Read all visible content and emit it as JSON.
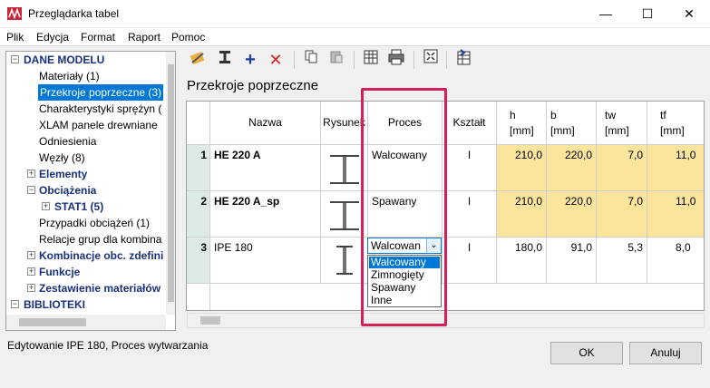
{
  "window": {
    "title": "Przeglądarka tabel"
  },
  "menu": [
    "Plik",
    "Edycja",
    "Format",
    "Raport",
    "Pomoc"
  ],
  "tree": {
    "root": "DANE MODELU",
    "items": [
      "Materiały (1)",
      "Przekroje poprzeczne (3)",
      "Charakterystyki sprężyn (",
      "XLAM panele drewniane",
      "Odniesienia",
      "Węzły (8)",
      "Elementy",
      "Obciążenia",
      "STAT1 (5)",
      "Przypadki obciążeń (1)",
      "Relacje grup dla kombina",
      "Kombinacje obc. zdefini",
      "Funkcje",
      "Zestawienie materiałów",
      "BIBLIOTEKI"
    ]
  },
  "panel": {
    "title": "Przekroje poprzeczne"
  },
  "grid": {
    "headers": [
      "Nazwa",
      "Rysunek",
      "Proces",
      "Kształt",
      "h\n[mm]",
      "b\n[mm]",
      "tw\n[mm]",
      "tf\n[mm]"
    ],
    "h_top": [
      "h",
      "b",
      "tw",
      "tf"
    ],
    "h_unit": [
      "[mm]",
      "[mm]",
      "[mm]",
      "[mm]"
    ],
    "rows": [
      {
        "n": "1",
        "name": "HE  220 A",
        "proces": "Walcowany",
        "shape": "I",
        "h": "210,0",
        "b": "220,0",
        "tw": "7,0",
        "tf": "11,0"
      },
      {
        "n": "2",
        "name": "HE  220 A_sp",
        "proces": "Spawany",
        "shape": "I",
        "h": "210,0",
        "b": "220,0",
        "tw": "7,0",
        "tf": "11,0"
      },
      {
        "n": "3",
        "name": "IPE 180",
        "proces": "Walcowan",
        "shape": "I",
        "h": "180,0",
        "b": "91,0",
        "tw": "5,3",
        "tf": "8,0"
      }
    ]
  },
  "dropdown": {
    "value": "Walcowan",
    "options": [
      "Walcowany",
      "Zimnogięty",
      "Spawany",
      "Inne"
    ]
  },
  "status": "Edytowanie IPE 180, Proces wytwarzania",
  "buttons": {
    "ok": "OK",
    "cancel": "Anuluj"
  },
  "colors": {
    "selection": "#0078d7",
    "highlight": "#d51f58",
    "editable": "#fbe49b"
  }
}
